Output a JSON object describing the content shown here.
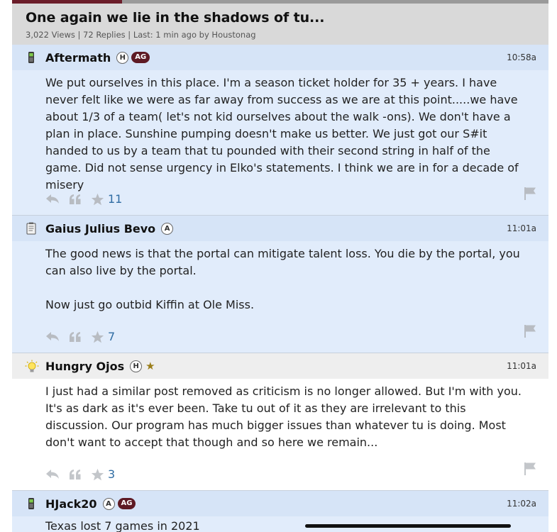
{
  "reading_progress": 0.205,
  "thread": {
    "title": "One again we lie in the shadows of tu...",
    "meta": "3,022 Views | 72 Replies | Last: 1 min ago by Houstonag"
  },
  "colors": {
    "brand": "#6b1d2a",
    "link": "#2f6ca3",
    "post_header_blue": "#d6e4f7",
    "post_body_blue": "#e1ecfb"
  },
  "posts": [
    {
      "author": "Aftermath",
      "status_icon": "phone-icon",
      "badges": [
        "H",
        "AG"
      ],
      "time": "10:58a",
      "body": [
        "We put ourselves in this place. I'm a season ticket holder for 35 + years. I have never felt like we were as far away from success as we are at this point.....we have about 1/3 of a team( let's not kid ourselves about the walk -ons). We don't have a plan in place. Sunshine pumping doesn't make us better. We just got our S#it handed to us by a team that tu pounded with their second string in half of the game. Did not sense urgency in Elko's statements. I think we are in for a decade of misery"
      ],
      "likes": "11"
    },
    {
      "author": "Gaius Julius Bevo",
      "status_icon": "notepad-icon",
      "badges": [
        "A"
      ],
      "time": "11:01a",
      "body": [
        "The good news is that the portal can mitigate talent loss. You die by the portal, you can also live by the portal.",
        "Now just go outbid Kiffin at Ole Miss."
      ],
      "likes": "7"
    },
    {
      "author": "Hungry Ojos",
      "status_icon": "lightbulb-icon",
      "badges": [
        "H",
        "star"
      ],
      "time": "11:01a",
      "body": [
        "I just had a similar post removed as criticism is no longer allowed. But I'm with you. It's as dark as it's ever been. Take tu out of it as they are irrelevant to this discussion. Our program has much bigger issues than whatever tu is doing. Most don't want to accept that though and so here we remain..."
      ],
      "likes": "3"
    },
    {
      "author": "HJack20",
      "status_icon": "phone-icon",
      "badges": [
        "A",
        "AG"
      ],
      "time": "11:02a",
      "body": [
        "Texas lost 7 games in 2021"
      ]
    }
  ]
}
